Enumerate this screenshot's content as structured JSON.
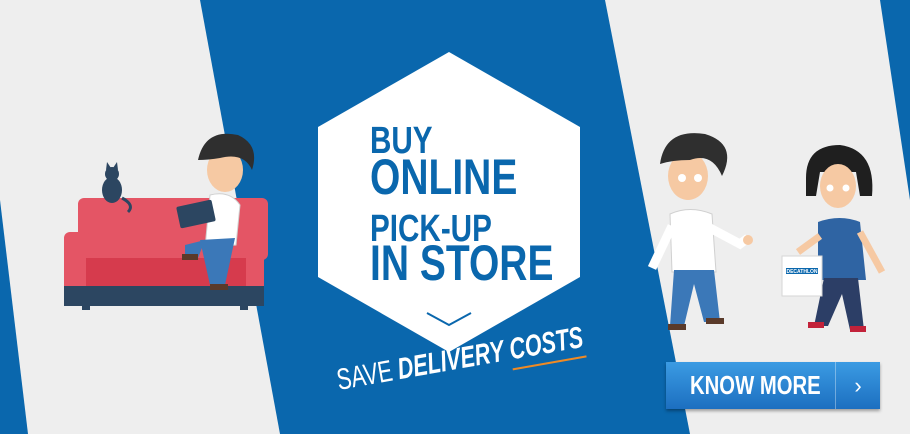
{
  "promo": {
    "headline_1": "BUY",
    "headline_2": "ONLINE",
    "headline_3": "PICK-UP",
    "headline_4": "IN STORE",
    "tagline_part1": "SAVE",
    "tagline_part2": "DELIVERY",
    "tagline_part3": "COSTS"
  },
  "cta": {
    "label": "KNOW MORE",
    "arrow": "›"
  },
  "bag_brand": "DECATHLON",
  "colors": {
    "brand_blue": "#0a67ad",
    "light_gray": "#eeeeee",
    "accent_orange": "#f08a24",
    "button_blue": "#2a86d6"
  },
  "icons": {
    "chevron": "chevron-down-icon",
    "arrow": "chevron-right-icon"
  }
}
